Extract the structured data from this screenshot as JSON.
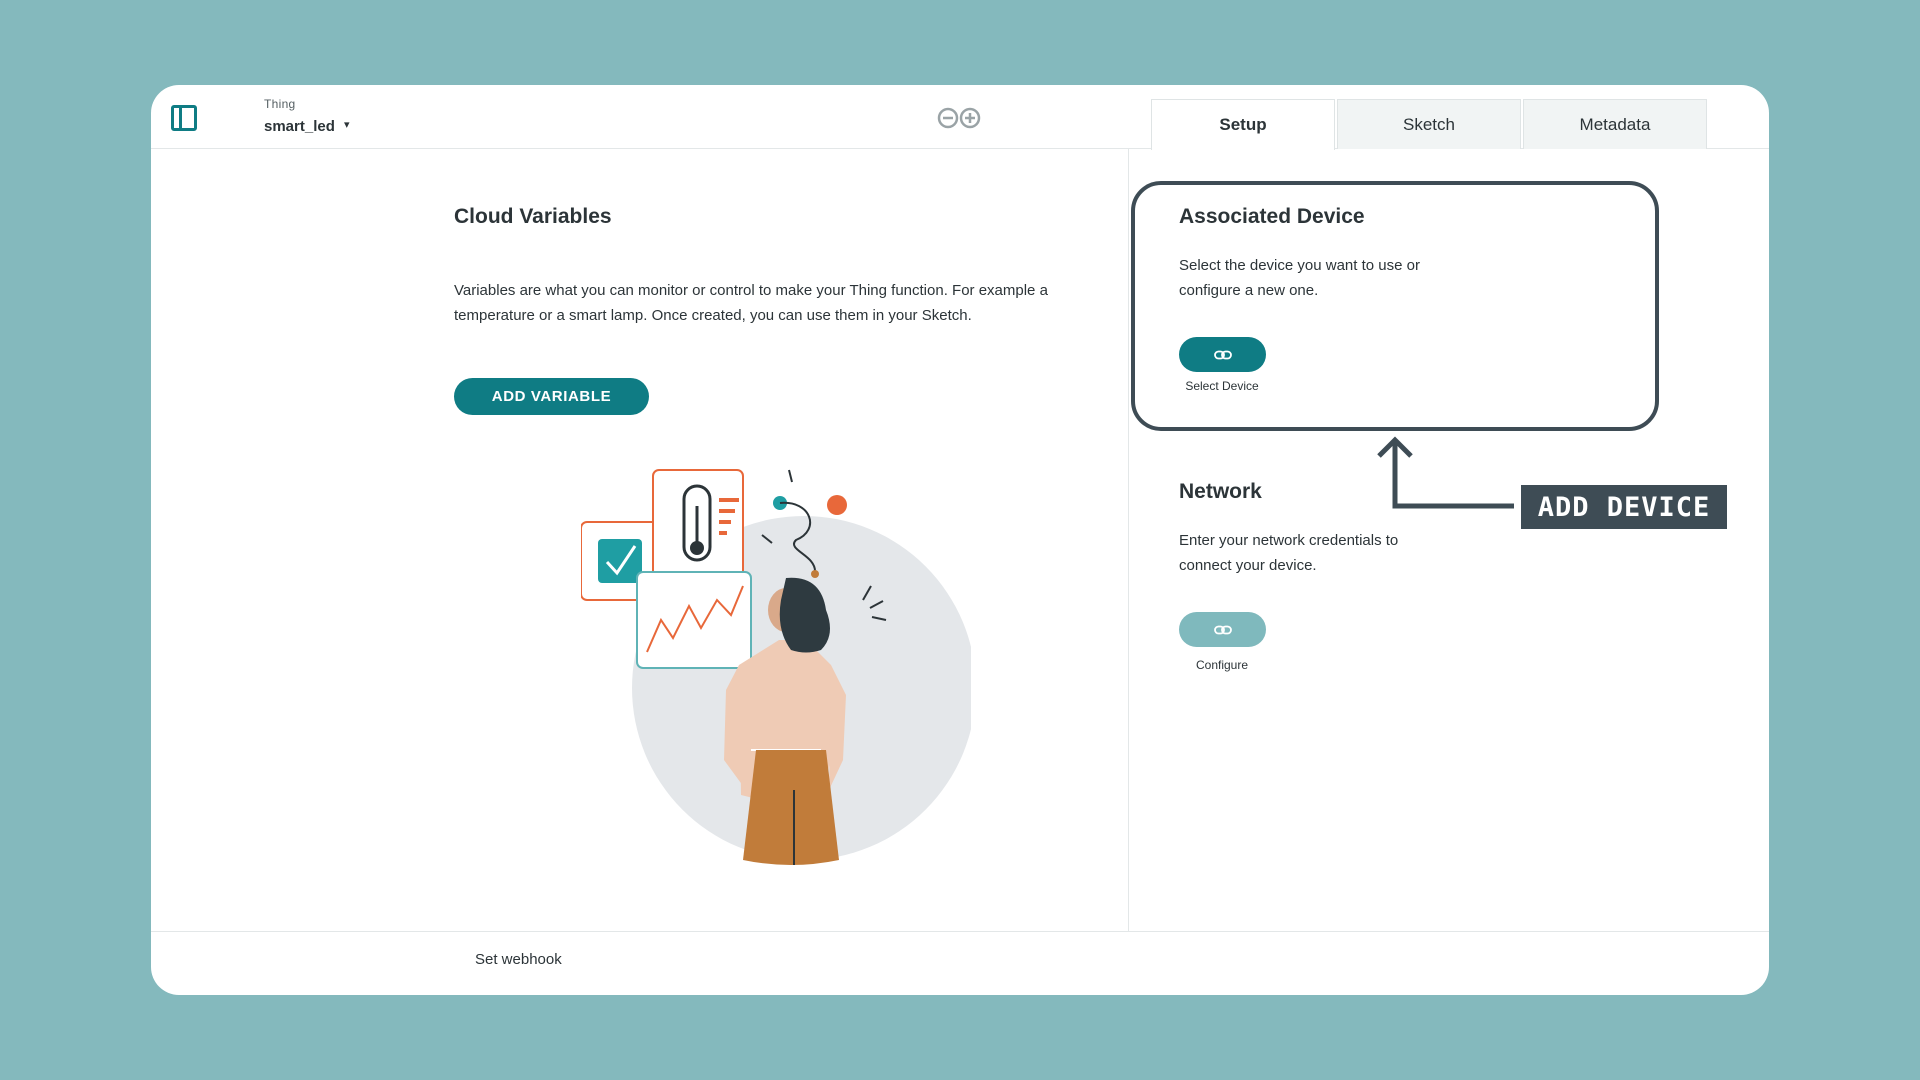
{
  "header": {
    "thing_label": "Thing",
    "thing_name": "smart_led",
    "thing_caret": "▾",
    "logo_icon": "arduino-logo-icon"
  },
  "tabs": [
    {
      "label": "Setup",
      "active": true
    },
    {
      "label": "Sketch",
      "active": false
    },
    {
      "label": "Metadata",
      "active": false
    }
  ],
  "cloud_variables": {
    "title": "Cloud Variables",
    "description": "Variables are what you can monitor or control to make your Thing function. For example a temperature or a smart lamp. Once created, you can use them in your Sketch.",
    "add_button": "ADD VARIABLE"
  },
  "associated_device": {
    "title": "Associated Device",
    "description": "Select the device you want to use or configure a new one.",
    "button_icon": "link-icon",
    "button_caption": "Select Device"
  },
  "network": {
    "title": "Network",
    "description": "Enter your network credentials to connect your device.",
    "button_icon": "link-icon",
    "button_caption": "Configure"
  },
  "annotation": {
    "label": "ADD DEVICE"
  },
  "footer": {
    "webhook_label": "Set webhook"
  },
  "colors": {
    "background": "#84b9bd",
    "accent": "#0f7c84",
    "accent_disabled": "#7fb9bd",
    "annotation": "#3e4c55",
    "orange": "#e8683a"
  }
}
